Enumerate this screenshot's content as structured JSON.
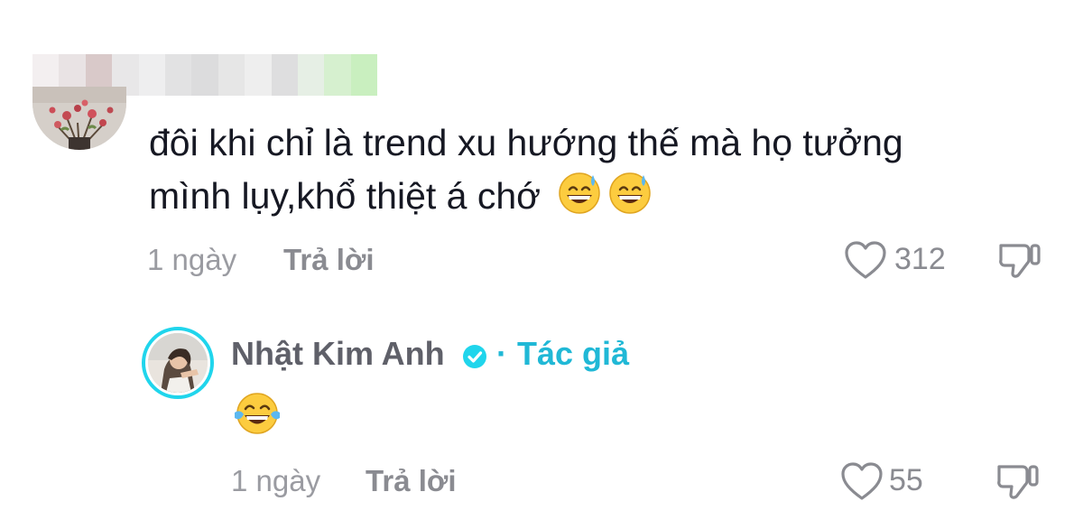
{
  "comment": {
    "line1": "đôi khi chỉ là trend xu hướng thế mà họ tưởng",
    "line2": "mình lụy,khổ thiệt á chớ",
    "emojis": [
      "grinning-sweat-face-emoji",
      "grinning-sweat-face-emoji"
    ],
    "time": "1 ngày",
    "reply_label": "Trả lời",
    "likes": "312"
  },
  "reply": {
    "author": "Nhật Kim Anh",
    "separator": "·",
    "author_tag": "Tác giả",
    "emoji": "tears-of-joy-emoji",
    "time": "1 ngày",
    "reply_label": "Trả lời",
    "likes": "55"
  },
  "colors": {
    "text": "#161823",
    "muted": "#8a8b91",
    "accent": "#20b8d6",
    "verified": "#20d5ec"
  },
  "icons": {
    "like": "heart-outline-icon",
    "dislike": "thumbs-down-icon",
    "verified": "verified-badge-icon"
  }
}
